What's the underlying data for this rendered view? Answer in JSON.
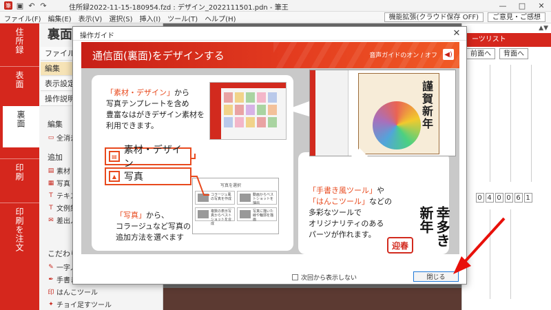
{
  "app": {
    "title": "住所録2022-11-15-180954.fzd : デザイン_2022111501.pdn - 筆王",
    "window_controls": [
      "—",
      "□",
      "✕"
    ]
  },
  "menu": {
    "items": [
      "ファイル(F)",
      "編集(E)",
      "表示(V)",
      "選択(S)",
      "挿入(I)",
      "ツール(T)",
      "ヘルプ(H)"
    ],
    "right_buttons": [
      "機能拡張(クラウド保存 OFF)",
      "ご意見・ご感想"
    ]
  },
  "left_tabs": [
    "住所録",
    "表面",
    "裏面",
    "印刷",
    "印刷を注文"
  ],
  "side_panel": {
    "title": "裏面",
    "rows": [
      "ファイル",
      "編集",
      "表示設定",
      "操作説明"
    ],
    "section_edit": "編集",
    "item_select_all": "全消去",
    "section_add": "追加",
    "add_items": [
      "素材・デ",
      "写真",
      "テキスト",
      "文例集",
      "差出人"
    ],
    "section_tools": "こだわりツール",
    "tool_items": [
      "一字入",
      "手書き風",
      "はんこツール",
      "チョイ足すツール"
    ]
  },
  "right_panel": {
    "header": "ーツリスト",
    "buttons": [
      "前面へ",
      "背面へ"
    ],
    "postal_digits": [
      "0",
      "4",
      "0",
      "0",
      "6",
      "1"
    ]
  },
  "modal": {
    "window_title": "操作ガイド",
    "heading": "通信面(裏面)をデザインする",
    "voice_toggle": "音声ガイドのオン / オフ",
    "block1_lines": [
      "「素材・デザイン」から",
      "写真テンプレートを含め",
      "豊富なはがきデザイン素材を",
      "利用できます。"
    ],
    "block1_highlight": "「素材・デザイン」",
    "tag_material": "素材・デザイン",
    "tag_photo": "写真",
    "block2_lines": [
      "「写真」から、",
      "コラージュなど写真の",
      "追加方法を選べます"
    ],
    "block2_highlight": "「写真」",
    "photo_menu": {
      "header": "写真を選択",
      "options": [
        "コラージュ風の写真を作成",
        "動画からベストショットを抽出",
        "複数の表示写真からベストショットを合成",
        "写真に描いた線や輪郭を描画"
      ]
    },
    "card_kanji": "謹賀新年",
    "block3_lines": [
      "「手書き風ツール」や",
      "「はんこツール」などの",
      "多彩なツールで",
      "オリジナリティのある",
      "パーツが作れます。"
    ],
    "block3_highlight1": "「手書き風ツール」",
    "block3_highlight2": "「はんこツール」",
    "brush_text": "幸多き新年",
    "hanko_text": "迎春",
    "dont_show_label": "次回から表示しない",
    "close_button": "閉じる"
  },
  "colors": {
    "brand_red": "#d5271d",
    "accent_orange": "#e8491d",
    "arrow_red": "#e8100a",
    "close_border": "#1e78d7"
  }
}
